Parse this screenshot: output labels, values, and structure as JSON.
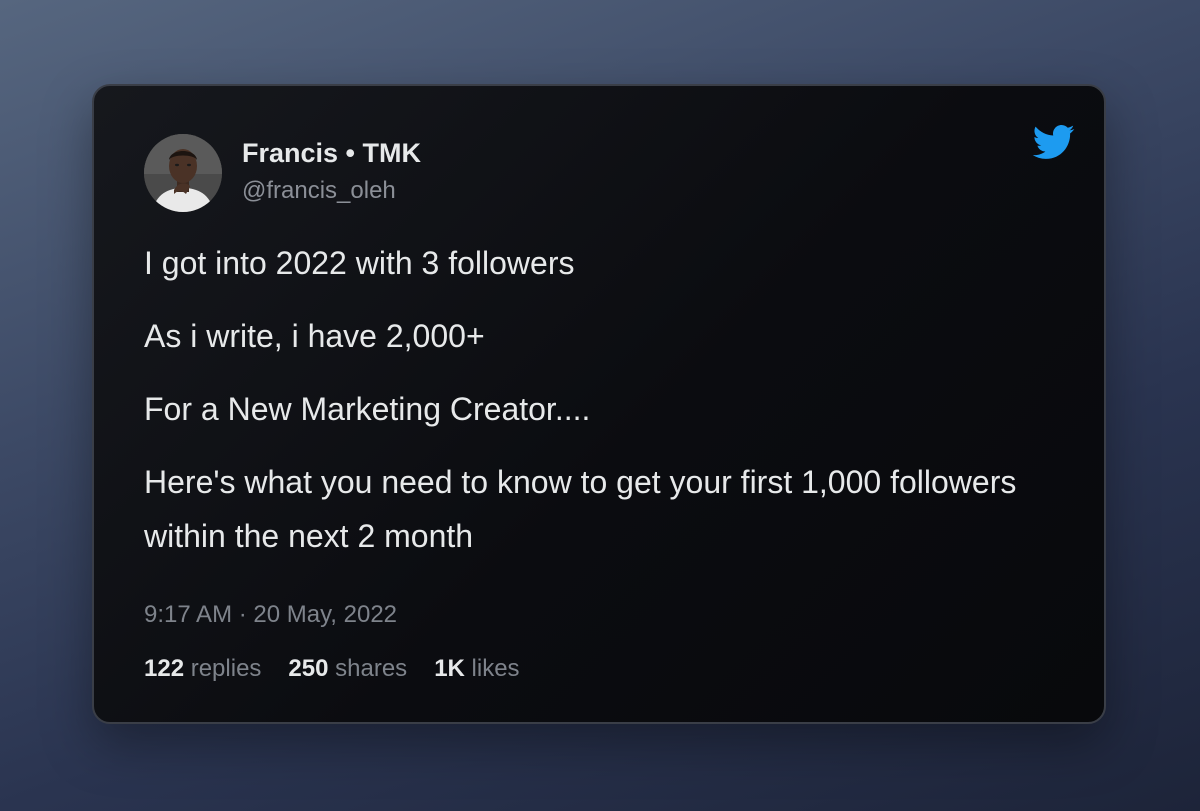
{
  "tweet": {
    "author": {
      "display_name": "Francis • TMK",
      "handle": "@francis_oleh"
    },
    "paragraphs": [
      "I got into 2022 with 3 followers",
      "As i write, i have 2,000+",
      "For a New Marketing Creator....",
      "Here's what you need to know to get your first 1,000 followers within the next 2 month"
    ],
    "timestamp": "9:17 AM · 20 May, 2022",
    "stats": {
      "replies_count": "122",
      "replies_label": "replies",
      "shares_count": "250",
      "shares_label": "shares",
      "likes_count": "1K",
      "likes_label": "likes"
    }
  },
  "icons": {
    "brand": "twitter-bird-icon",
    "brand_color": "#1d9bf0"
  }
}
